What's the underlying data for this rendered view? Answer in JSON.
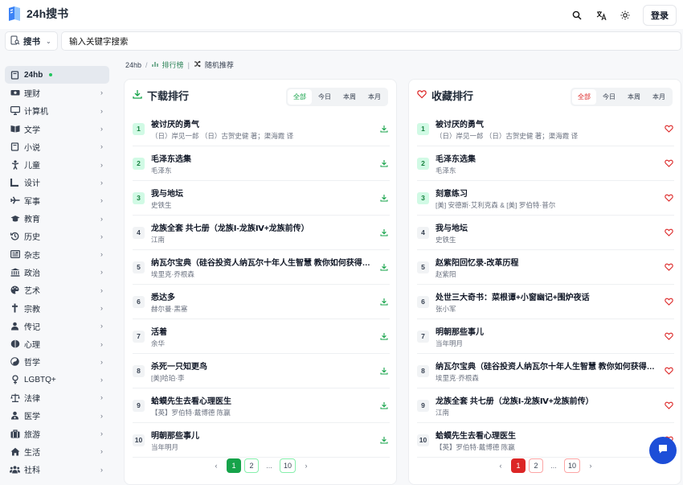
{
  "brand": {
    "name": "24h搜书"
  },
  "header": {
    "login_label": "登录"
  },
  "search": {
    "type_label": "搜书",
    "placeholder": "输入关键字搜索"
  },
  "breadcrumb": {
    "home": "24hb",
    "sep": "/",
    "ranking": "排行榜",
    "divider": "|",
    "random": "随机推荐"
  },
  "sidebar": {
    "items": [
      {
        "label": "24hb",
        "icon": "book-icon",
        "active": true
      },
      {
        "label": "理财",
        "icon": "money-icon"
      },
      {
        "label": "计算机",
        "icon": "monitor-icon"
      },
      {
        "label": "文学",
        "icon": "open-book-icon"
      },
      {
        "label": "小说",
        "icon": "book-icon"
      },
      {
        "label": "儿童",
        "icon": "child-icon"
      },
      {
        "label": "设计",
        "icon": "ruler-icon"
      },
      {
        "label": "军事",
        "icon": "plane-icon"
      },
      {
        "label": "教育",
        "icon": "graduation-cap-icon"
      },
      {
        "label": "历史",
        "icon": "history-icon"
      },
      {
        "label": "杂志",
        "icon": "newspaper-icon"
      },
      {
        "label": "政治",
        "icon": "building-columns-icon"
      },
      {
        "label": "艺术",
        "icon": "palette-icon"
      },
      {
        "label": "宗教",
        "icon": "cross-icon"
      },
      {
        "label": "传记",
        "icon": "person-icon"
      },
      {
        "label": "心理",
        "icon": "brain-icon"
      },
      {
        "label": "哲学",
        "icon": "yin-yang-icon"
      },
      {
        "label": "LGBTQ+",
        "icon": "gender-icon"
      },
      {
        "label": "法律",
        "icon": "scales-icon"
      },
      {
        "label": "医学",
        "icon": "doctor-icon"
      },
      {
        "label": "旅游",
        "icon": "suitcase-icon"
      },
      {
        "label": "生活",
        "icon": "house-icon"
      },
      {
        "label": "社科",
        "icon": "people-icon"
      }
    ]
  },
  "download_panel": {
    "title": "下载排行",
    "tabs": [
      "全部",
      "今日",
      "本周",
      "本月"
    ],
    "items": [
      {
        "rank": "1",
        "title": "被讨厌的勇气",
        "author": "（日）岸见一郎 （日）古贺史健 著；渠海霞 译"
      },
      {
        "rank": "2",
        "title": "毛泽东选集",
        "author": "毛泽东"
      },
      {
        "rank": "3",
        "title": "我与地坛",
        "author": "史铁生"
      },
      {
        "rank": "4",
        "title": "龙族全套 共七册（龙族Ⅰ-龙族Ⅳ+龙族前传）",
        "author": "江南"
      },
      {
        "rank": "5",
        "title": "纳瓦尔宝典（硅谷投资人纳瓦尔十年人生智慧 教你如何获得财富与幸福）",
        "author": "埃里克·乔根森"
      },
      {
        "rank": "6",
        "title": "悉达多",
        "author": "赫尔曼·黑塞"
      },
      {
        "rank": "7",
        "title": "活着",
        "author": "余华"
      },
      {
        "rank": "8",
        "title": "杀死一只知更鸟",
        "author": "[美]哈珀·李"
      },
      {
        "rank": "9",
        "title": "蛤蟆先生去看心理医生",
        "author": "【英】罗伯特·戴博德 陈赢"
      },
      {
        "rank": "10",
        "title": "明朝那些事儿",
        "author": "当年明月"
      }
    ],
    "pager": {
      "p1": "1",
      "p2": "2",
      "ellipsis": "...",
      "last": "10"
    }
  },
  "favorite_panel": {
    "title": "收藏排行",
    "tabs": [
      "全部",
      "今日",
      "本周",
      "本月"
    ],
    "items": [
      {
        "rank": "1",
        "title": "被讨厌的勇气",
        "author": "（日）岸见一郎 （日）古贺史健 著；渠海霞 译"
      },
      {
        "rank": "2",
        "title": "毛泽东选集",
        "author": "毛泽东"
      },
      {
        "rank": "3",
        "title": "刻意练习",
        "author": "[美] 安德斯·艾利克森 & [美] 罗伯特·普尔"
      },
      {
        "rank": "4",
        "title": "我与地坛",
        "author": "史铁生"
      },
      {
        "rank": "5",
        "title": "赵紫阳回忆录-改革历程",
        "author": "赵紫阳"
      },
      {
        "rank": "6",
        "title": "处世三大奇书：菜根谭+小窗幽记+围炉夜话",
        "author": "张小军"
      },
      {
        "rank": "7",
        "title": "明朝那些事儿",
        "author": "当年明月"
      },
      {
        "rank": "8",
        "title": "纳瓦尔宝典（硅谷投资人纳瓦尔十年人生智慧 教你如何获得财富与幸福）",
        "author": "埃里克·乔根森"
      },
      {
        "rank": "9",
        "title": "龙族全套 共七册（龙族Ⅰ-龙族Ⅳ+龙族前传）",
        "author": "江南"
      },
      {
        "rank": "10",
        "title": "蛤蟆先生去看心理医生",
        "author": "【英】罗伯特·戴博德 陈赢"
      }
    ],
    "pager": {
      "p1": "1",
      "p2": "2",
      "ellipsis": "...",
      "last": "10"
    }
  },
  "colors": {
    "green": "#16a34a",
    "red": "#dc2626",
    "fab": "#1d4ed8"
  }
}
